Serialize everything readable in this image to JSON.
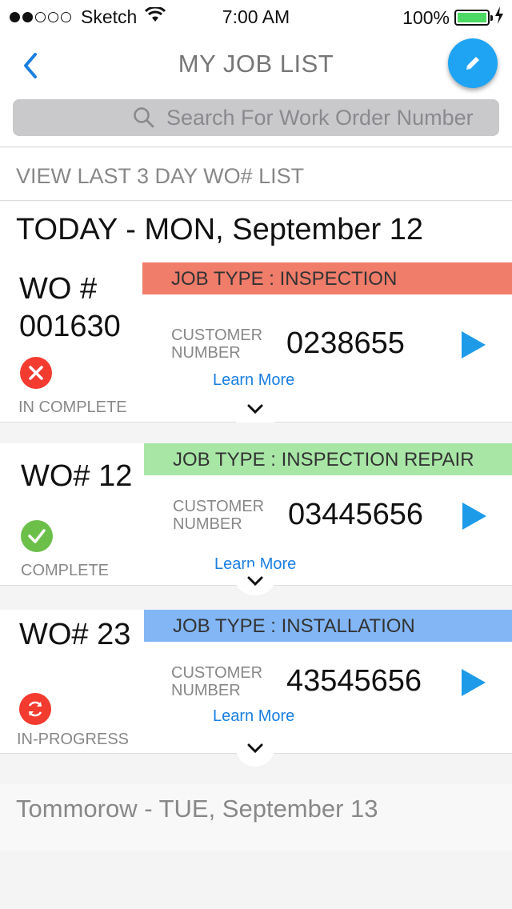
{
  "status_bar": {
    "carrier": "Sketch",
    "time": "7:00 AM",
    "battery": "100%"
  },
  "nav": {
    "title": "MY JOB LIST"
  },
  "search": {
    "placeholder": "Search For Work Order Number"
  },
  "last_days_link": "VIEW LAST 3 DAY WO# LIST",
  "today_heading": "TODAY - MON, September 12",
  "jobs": [
    {
      "wo": "WO #\n001630",
      "job_type": "JOB TYPE : INSPECTION",
      "job_type_color": "#f07c6a",
      "customer_label": "CUSTOMER\nNUMBER",
      "customer_number": "0238655",
      "learn_more": "Learn More",
      "status": "IN COMPLETE",
      "status_icon": "close-circle-icon"
    },
    {
      "wo": "WO# 12",
      "job_type": "JOB TYPE : INSPECTION REPAIR",
      "job_type_color": "#a8e6a6",
      "customer_label": "CUSTOMER\nNUMBER",
      "customer_number": "03445656",
      "learn_more": "Learn More",
      "status": "COMPLETE",
      "status_icon": "check-circle-icon"
    },
    {
      "wo": "WO# 23",
      "job_type": "JOB TYPE : INSTALLATION",
      "job_type_color": "#82b6f5",
      "customer_label": "CUSTOMER\nNUMBER",
      "customer_number": "43545656",
      "learn_more": "Learn More",
      "status": "IN-PROGRESS",
      "status_icon": "refresh-circle-icon"
    }
  ],
  "tomorrow_heading": "Tommorow - TUE, September 13",
  "colors": {
    "accent": "#1ea4f3",
    "play": "#1e9be8",
    "complete": "#6cc04a",
    "incomplete": "#f43b30"
  }
}
